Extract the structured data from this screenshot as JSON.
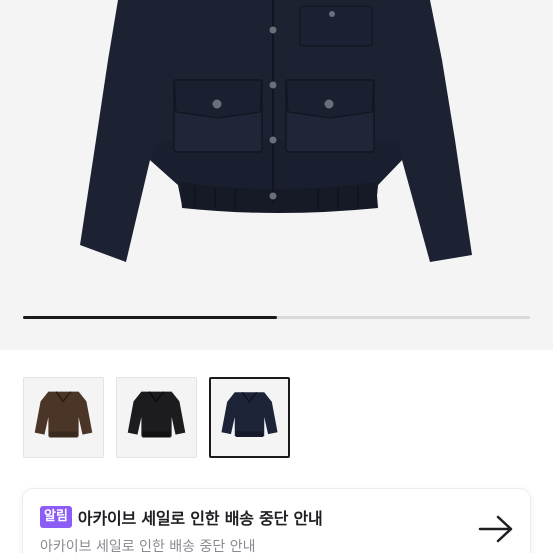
{
  "product": {
    "image_icon": "jacket-navy",
    "gallery_progress": 0.5,
    "thumbnails": [
      {
        "icon": "jacket-brown",
        "color": "#4a3526",
        "selected": false
      },
      {
        "icon": "jacket-black",
        "color": "#1c1c1f",
        "selected": false
      },
      {
        "icon": "jacket-navy",
        "color": "#1d2438",
        "selected": true
      }
    ]
  },
  "notice": {
    "badge": "알림",
    "title": "아카이브 세일로 인한 배송 중단 안내",
    "subtitle": "아카이브 세일로 인한 배송 중단 안내",
    "arrow_icon": "arrow-right-icon",
    "badge_color": "#8b5cf6"
  }
}
